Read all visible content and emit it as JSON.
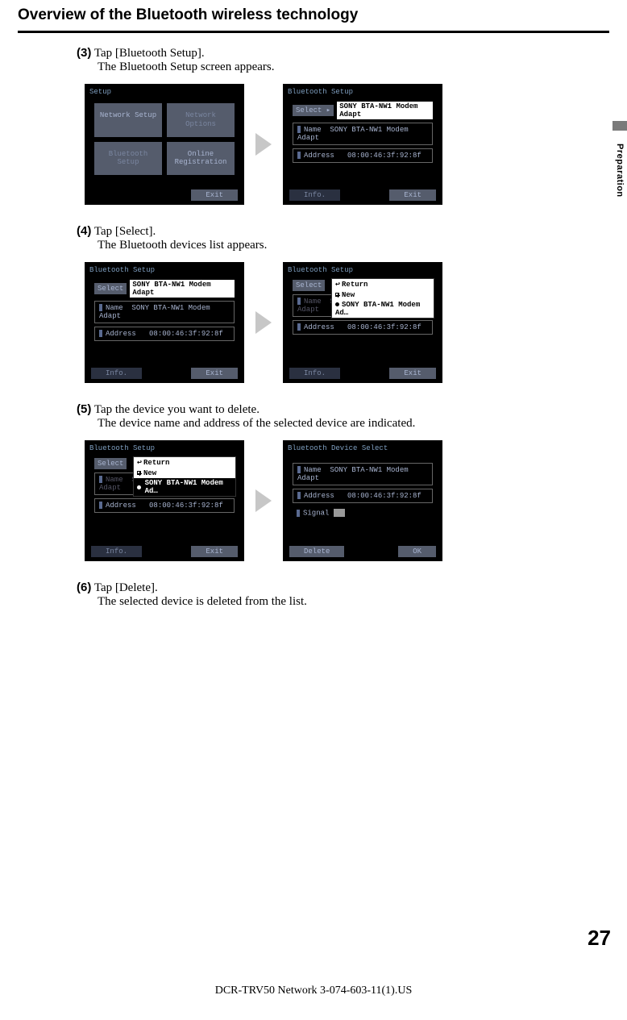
{
  "title": "Overview of the Bluetooth wireless technology",
  "side_tab": "Preparation",
  "page_number": "27",
  "footer": "DCR-TRV50 Network 3-074-603-11(1).US",
  "steps": {
    "s3": {
      "num": "(3)",
      "text": "Tap [Bluetooth Setup].",
      "sub": "The Bluetooth Setup screen appears."
    },
    "s4": {
      "num": "(4)",
      "text": "Tap [Select].",
      "sub": "The Bluetooth devices list appears."
    },
    "s5": {
      "num": "(5)",
      "text": "Tap the device you want to delete.",
      "sub": "The device name and address of the selected device are indicated."
    },
    "s6": {
      "num": "(6)",
      "text": "Tap [Delete].",
      "sub": "The selected device is deleted from the list."
    }
  },
  "screens": {
    "setup": {
      "title": "Setup",
      "network_setup": "Network Setup",
      "network_options": "Network Options",
      "bluetooth_setup": "Bluetooth Setup",
      "online_reg_l1": "Online",
      "online_reg_l2": "Registration",
      "exit": "Exit"
    },
    "bt_setup": {
      "title": "Bluetooth Setup",
      "select": "Select",
      "device": "SONY BTA-NW1 Modem Adapt",
      "device_trunc": "SONY BTA-NW1 Modem Ad…",
      "device_faded": "SONY BTA-NW1 Modem Adapt",
      "name_label": "Name",
      "name_value": "SONY BTA-NW1 Modem Adapt",
      "addr_label": "Address",
      "addr_value": "08:00:46:3f:92:8f",
      "info": "Info.",
      "exit": "Exit",
      "return": "Return",
      "new": "New"
    },
    "device_select": {
      "title": "Bluetooth Device Select",
      "name_label": "Name",
      "name_value": "SONY BTA-NW1 Modem Adapt",
      "addr_label": "Address",
      "addr_value": "08:00:46:3f:92:8f",
      "signal_label": "Signal",
      "delete": "Delete",
      "ok": "OK"
    }
  }
}
